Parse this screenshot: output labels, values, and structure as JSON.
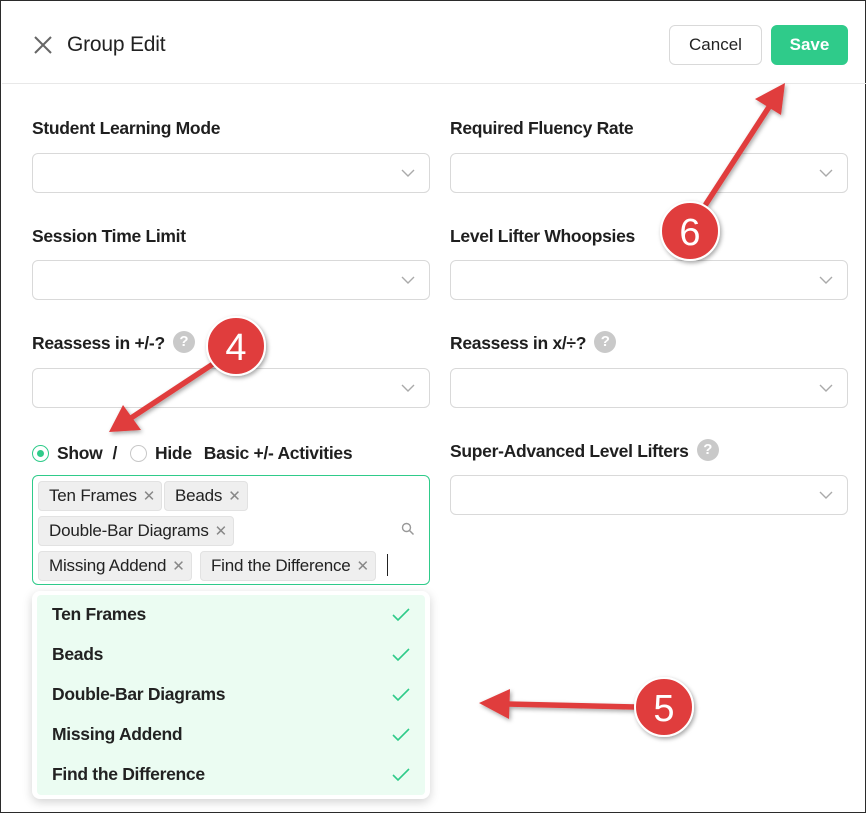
{
  "header": {
    "title": "Group Edit",
    "cancel_label": "Cancel",
    "save_label": "Save"
  },
  "fields": {
    "student_learning_mode": {
      "label": "Student Learning Mode",
      "value": ""
    },
    "required_fluency_rate": {
      "label": "Required Fluency Rate",
      "value": ""
    },
    "session_time_limit": {
      "label": "Session Time Limit",
      "value": ""
    },
    "level_lifter_whoopsies": {
      "label": "Level Lifter Whoopsies",
      "value": ""
    },
    "reassess_add_sub": {
      "label": "Reassess in +/-?",
      "value": ""
    },
    "reassess_mul_div": {
      "label": "Reassess in x/÷?",
      "value": ""
    },
    "super_advanced": {
      "label": "Super-Advanced Level Lifters",
      "value": ""
    }
  },
  "help_icon_glyph": "?",
  "basic_activities": {
    "show_label": "Show",
    "separator": "/",
    "hide_label": "Hide",
    "label": "Basic +/- Activities",
    "selected": "Show",
    "tags": [
      "Ten Frames",
      "Beads",
      "Double-Bar Diagrams",
      "Missing Addend",
      "Find the Difference"
    ]
  },
  "dropdown": {
    "options": [
      {
        "label": "Ten Frames",
        "checked": true
      },
      {
        "label": "Beads",
        "checked": true
      },
      {
        "label": "Double-Bar Diagrams",
        "checked": true
      },
      {
        "label": "Missing Addend",
        "checked": true
      },
      {
        "label": "Find the Difference",
        "checked": true
      }
    ]
  },
  "annotations": {
    "callout_4": "4",
    "callout_5": "5",
    "callout_6": "6",
    "callout_color": "#e03c3c"
  },
  "colors": {
    "accent": "#2fcb8a",
    "dropdown_bg": "#ebfcf2"
  }
}
